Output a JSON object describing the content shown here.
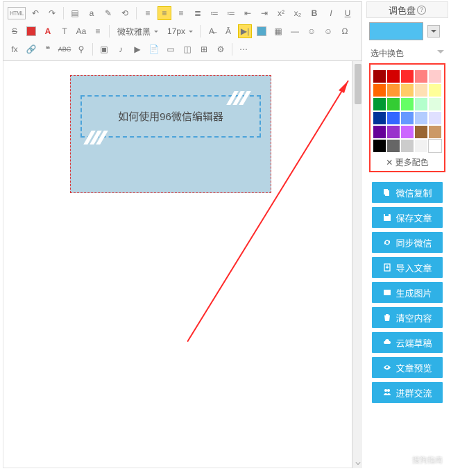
{
  "toolbar": {
    "html_label": "HTML",
    "font_family": "微软雅黑",
    "font_size": "17px",
    "row1": [
      "undo",
      "redo",
      "|",
      "new-doc",
      "template",
      "bgcolor",
      "autoformat",
      "|",
      "align-left",
      "align-center",
      "align-right",
      "align-justify",
      "list-ol",
      "list-ul",
      "indent-left",
      "indent-right",
      "sup",
      "sub"
    ],
    "row2": [
      "bold",
      "italic",
      "underline",
      "strike",
      "forecolor-pick",
      "forecolor",
      "format-paint",
      "case",
      "lineheight",
      "|",
      "font-family",
      "font-size",
      "|",
      "clear-format",
      "font-bg",
      "direction",
      "help"
    ],
    "row3": [
      "table",
      "hr",
      "emoji",
      "smiley",
      "symbol",
      "fx",
      "link",
      "quote",
      "strike2",
      "findreplace",
      "|",
      "image",
      "music",
      "video",
      "file",
      "card",
      "component",
      "iframe",
      "plugin",
      "|",
      "more"
    ],
    "labels": {
      "bold": "B",
      "italic": "I",
      "underline": "U",
      "strike": "S",
      "forecolor": "A",
      "forecolor-pick": "A",
      "format-paint": "T",
      "case": "Aa",
      "sup": "x²",
      "sub": "x₂",
      "quote": "❝",
      "strike2": "ABC",
      "symbol": "Ω",
      "smiley": "☺",
      "emoji": "☺",
      "fx": "fx",
      "findreplace": "⚲"
    }
  },
  "canvas": {
    "text": "如何使用96微信编辑器"
  },
  "panel": {
    "title": "调色盘",
    "select_replace": "选中换色",
    "more_color": "✕ 更多配色",
    "current_color": "#50c0f0",
    "colors": [
      "#a30000",
      "#d40000",
      "#ff2a2a",
      "#ff8080",
      "#ffcccc",
      "#ff6600",
      "#ff9933",
      "#ffcc66",
      "#ffe0b3",
      "#ffff99",
      "#009933",
      "#33cc33",
      "#66ff66",
      "#b3ffcc",
      "#e0ffe0",
      "#003399",
      "#3366ff",
      "#6699ff",
      "#b3ccff",
      "#e0e0ff",
      "#660099",
      "#9933cc",
      "#cc66ff",
      "#996633",
      "#cc9966",
      "#000000",
      "#666666",
      "#cccccc",
      "#f2f2f2",
      "#ffffff"
    ],
    "actions": [
      {
        "icon": "copy",
        "label": "微信复制"
      },
      {
        "icon": "save",
        "label": "保存文章"
      },
      {
        "icon": "sync",
        "label": "同步微信"
      },
      {
        "icon": "import",
        "label": "导入文章"
      },
      {
        "icon": "image",
        "label": "生成图片"
      },
      {
        "icon": "trash",
        "label": "清空内容"
      },
      {
        "icon": "cloud",
        "label": "云端草稿"
      },
      {
        "icon": "eye",
        "label": "文章预览"
      },
      {
        "icon": "group",
        "label": "进群交流"
      }
    ]
  }
}
